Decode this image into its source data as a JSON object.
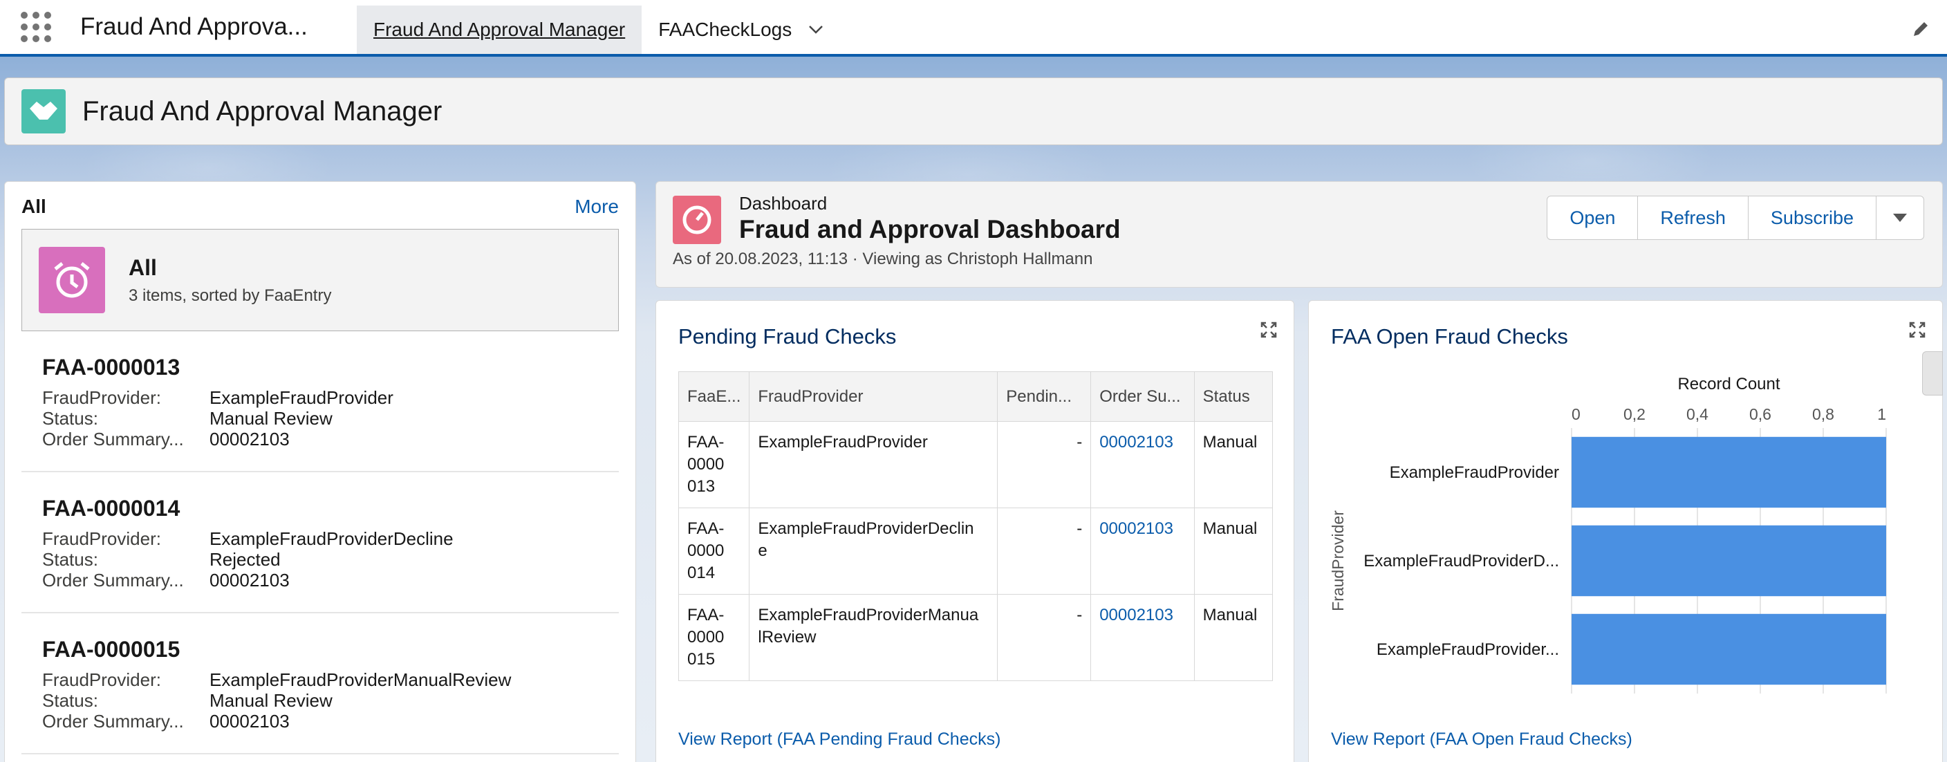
{
  "nav": {
    "app_name": "Fraud And Approva...",
    "tabs": [
      {
        "label": "Fraud And Approval Manager"
      },
      {
        "label": "FAACheckLogs"
      }
    ]
  },
  "header": {
    "title": "Fraud And Approval Manager"
  },
  "list": {
    "title": "All",
    "more": "More",
    "view_name": "All",
    "view_info": "3 items, sorted by FaaEntry",
    "field_labels": {
      "provider": "FraudProvider:",
      "status": "Status:",
      "order": "Order Summary..."
    },
    "records": [
      {
        "id": "FAA-0000013",
        "provider": "ExampleFraudProvider",
        "status": "Manual Review",
        "order": "00002103"
      },
      {
        "id": "FAA-0000014",
        "provider": "ExampleFraudProviderDecline",
        "status": "Rejected",
        "order": "00002103"
      },
      {
        "id": "FAA-0000015",
        "provider": "ExampleFraudProviderManualReview",
        "status": "Manual Review",
        "order": "00002103"
      }
    ]
  },
  "dashboard": {
    "label": "Dashboard",
    "title": "Fraud and Approval Dashboard",
    "subtitle": "As of 20.08.2023, 11:13 · Viewing as Christoph Hallmann",
    "buttons": {
      "open": "Open",
      "refresh": "Refresh",
      "subscribe": "Subscribe"
    }
  },
  "pending": {
    "title": "Pending Fraud Checks",
    "columns": [
      "FaaE...",
      "FraudProvider",
      "Pendin...",
      "Order Su...",
      "Status"
    ],
    "rows": [
      {
        "entry": "FAA-\n0000\n013",
        "provider": "ExampleFraudProvider",
        "pending": "-",
        "order": "00002103",
        "status": "Manual"
      },
      {
        "entry": "FAA-\n0000\n014",
        "provider": "ExampleFraudProviderDeclin\ne",
        "pending": "-",
        "order": "00002103",
        "status": "Manual"
      },
      {
        "entry": "FAA-\n0000\n015",
        "provider": "ExampleFraudProviderManua\nlReview",
        "pending": "-",
        "order": "00002103",
        "status": "Manual"
      }
    ],
    "footer": "View Report (FAA Pending Fraud Checks)"
  },
  "open_checks": {
    "title": "FAA Open Fraud Checks",
    "footer": "View Report (FAA Open Fraud Checks)"
  },
  "chart_data": {
    "type": "bar",
    "orientation": "horizontal",
    "title": "",
    "xlabel": "Record Count",
    "ylabel": "FraudProvider",
    "categories": [
      "ExampleFraudProvider",
      "ExampleFraudProviderD...",
      "ExampleFraudProvider..."
    ],
    "values": [
      1,
      1,
      1
    ],
    "xlim": [
      0,
      1
    ],
    "ticks": [
      "0",
      "0,2",
      "0,4",
      "0,6",
      "0,8",
      "1"
    ],
    "tick_values": [
      0,
      0.2,
      0.4,
      0.6,
      0.8,
      1
    ],
    "bar_color": "#4a90e2",
    "grid": true
  }
}
